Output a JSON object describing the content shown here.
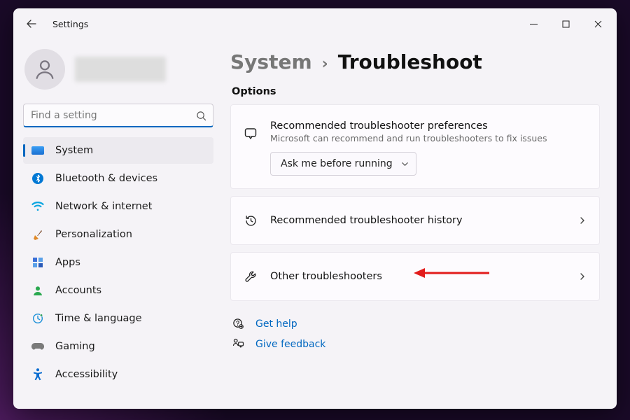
{
  "window": {
    "app_title": "Settings"
  },
  "search": {
    "placeholder": "Find a setting"
  },
  "sidebar": {
    "items": [
      {
        "label": "System"
      },
      {
        "label": "Bluetooth & devices"
      },
      {
        "label": "Network & internet"
      },
      {
        "label": "Personalization"
      },
      {
        "label": "Apps"
      },
      {
        "label": "Accounts"
      },
      {
        "label": "Time & language"
      },
      {
        "label": "Gaming"
      },
      {
        "label": "Accessibility"
      }
    ]
  },
  "breadcrumb": {
    "parent": "System",
    "sep": "›",
    "current": "Troubleshoot"
  },
  "section_label": "Options",
  "options": {
    "rec_prefs": {
      "title": "Recommended troubleshooter preferences",
      "subtitle": "Microsoft can recommend and run troubleshooters to fix issues",
      "dropdown_value": "Ask me before running"
    },
    "history": {
      "title": "Recommended troubleshooter history"
    },
    "other": {
      "title": "Other troubleshooters"
    }
  },
  "footer": {
    "help": "Get help",
    "feedback": "Give feedback"
  }
}
